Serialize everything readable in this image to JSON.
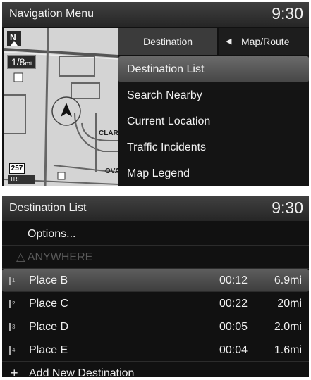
{
  "nav_menu": {
    "title": "Navigation Menu",
    "clock": "9:30",
    "map": {
      "scale": "1/8",
      "scale_unit": "mi",
      "street_1": "CLAR",
      "street_2": "OVA",
      "route_number": "257",
      "traffic_label": "TRF"
    },
    "tabs": {
      "destination": "Destination",
      "map_route": "Map/Route"
    },
    "items": [
      {
        "label": "Destination List"
      },
      {
        "label": "Search Nearby"
      },
      {
        "label": "Current Location"
      },
      {
        "label": "Traffic Incidents"
      },
      {
        "label": "Map Legend"
      }
    ]
  },
  "dest_list": {
    "title": "Destination List",
    "clock": "9:30",
    "options_label": "Options...",
    "anywhere_label": "ANYWHERE",
    "places": [
      {
        "num": "1",
        "name": "Place B",
        "time": "00:12",
        "distance": "6.9mi"
      },
      {
        "num": "2",
        "name": "Place C",
        "time": "00:22",
        "distance": "20mi"
      },
      {
        "num": "3",
        "name": "Place D",
        "time": "00:05",
        "distance": "2.0mi"
      },
      {
        "num": "4",
        "name": "Place E",
        "time": "00:04",
        "distance": "1.6mi"
      }
    ],
    "add_label": "Add New Destination"
  }
}
